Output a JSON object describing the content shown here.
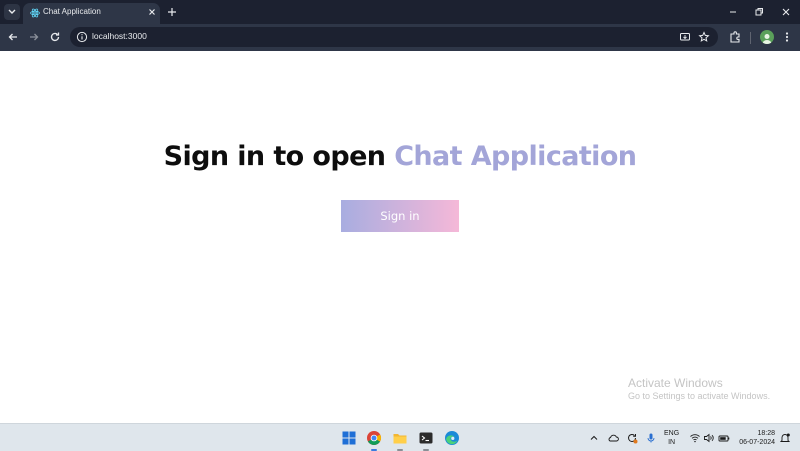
{
  "browser": {
    "tab_title": "Chat Application",
    "url": "localhost:3000",
    "accent_tab_bg": "#2e3647",
    "tabbar_bg": "#1c2130"
  },
  "page": {
    "headline_prefix": "Sign in to open ",
    "headline_accent": "Chat Application",
    "signin_label": "Sign in",
    "accent_color": "#a3a5d8",
    "button_gradient": [
      "#a8ade0",
      "#f5b8d8"
    ]
  },
  "watermark": {
    "title": "Activate Windows",
    "subtitle": "Go to Settings to activate Windows."
  },
  "taskbar": {
    "apps": [
      "windows-start",
      "chrome",
      "file-explorer",
      "terminal",
      "edge"
    ],
    "lang_line1": "ENG",
    "lang_line2": "IN",
    "time": "18:28",
    "date": "06-07-2024"
  }
}
